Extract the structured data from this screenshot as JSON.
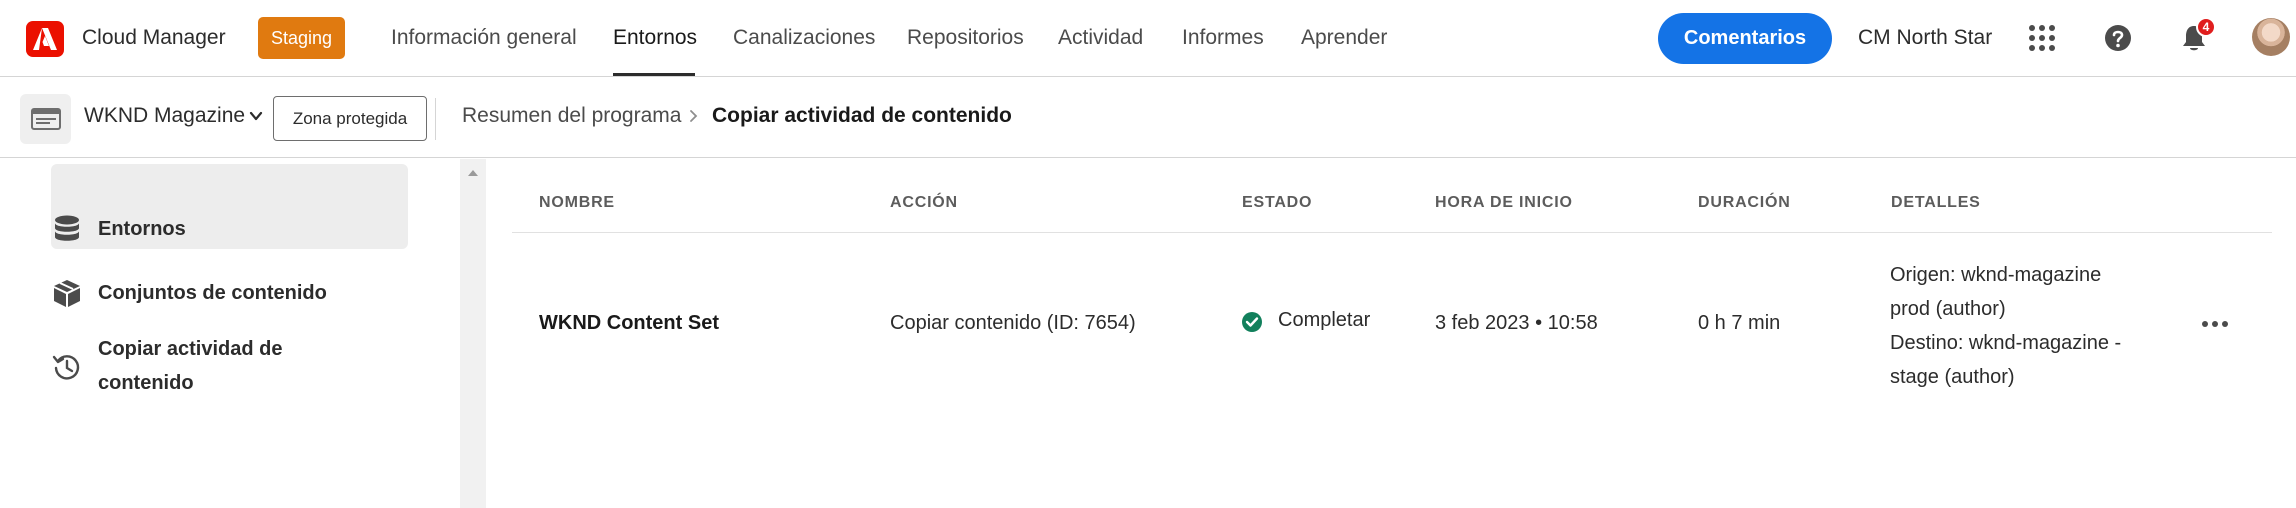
{
  "header": {
    "app_title": "Cloud Manager",
    "env_badge": "Staging",
    "tabs": [
      {
        "label": "Información general",
        "active": false
      },
      {
        "label": "Entornos",
        "active": true
      },
      {
        "label": "Canalizaciones",
        "active": false
      },
      {
        "label": "Repositorios",
        "active": false
      },
      {
        "label": "Actividad",
        "active": false
      },
      {
        "label": "Informes",
        "active": false
      },
      {
        "label": "Aprender",
        "active": false
      }
    ],
    "feedback_label": "Comentarios",
    "org_name": "CM North Star",
    "notification_count": "4",
    "icons": [
      "adobe-logo",
      "apps-grid-icon",
      "help-icon",
      "bell-icon",
      "avatar"
    ]
  },
  "subheader": {
    "program_name": "WKND Magazine",
    "sandbox_tag": "Zona protegida",
    "breadcrumb_link": "Resumen del programa",
    "breadcrumb_current": "Copiar actividad de contenido"
  },
  "sidebar": {
    "items": [
      {
        "label": "Entornos",
        "icon": "database-icon",
        "selected": false
      },
      {
        "label": "Conjuntos de contenido",
        "icon": "box-icon",
        "selected": false
      },
      {
        "label_line1": "Copiar actividad de",
        "label_line2": "contenido",
        "icon": "history-icon",
        "selected": true
      }
    ]
  },
  "table": {
    "columns": [
      "NOMBRE",
      "ACCIÓN",
      "ESTADO",
      "HORA DE INICIO",
      "DURACIÓN",
      "DETALLES"
    ],
    "rows": [
      {
        "name": "WKND Content Set",
        "action": "Copiar contenido (ID: 7654)",
        "status": "Completar",
        "start_time": "3 feb 2023 • 10:58",
        "duration": "0 h 7 min",
        "details": {
          "line1": "Origen: wknd-magazine",
          "line2": "prod (author)",
          "line3": "Destino: wknd-magazine -",
          "line4": "stage (author)"
        }
      }
    ]
  },
  "colors": {
    "accent": "#1473e6",
    "staging": "#e07a10",
    "adobe_red": "#eb1000",
    "success": "#12805c",
    "notification": "#e01e1e"
  }
}
